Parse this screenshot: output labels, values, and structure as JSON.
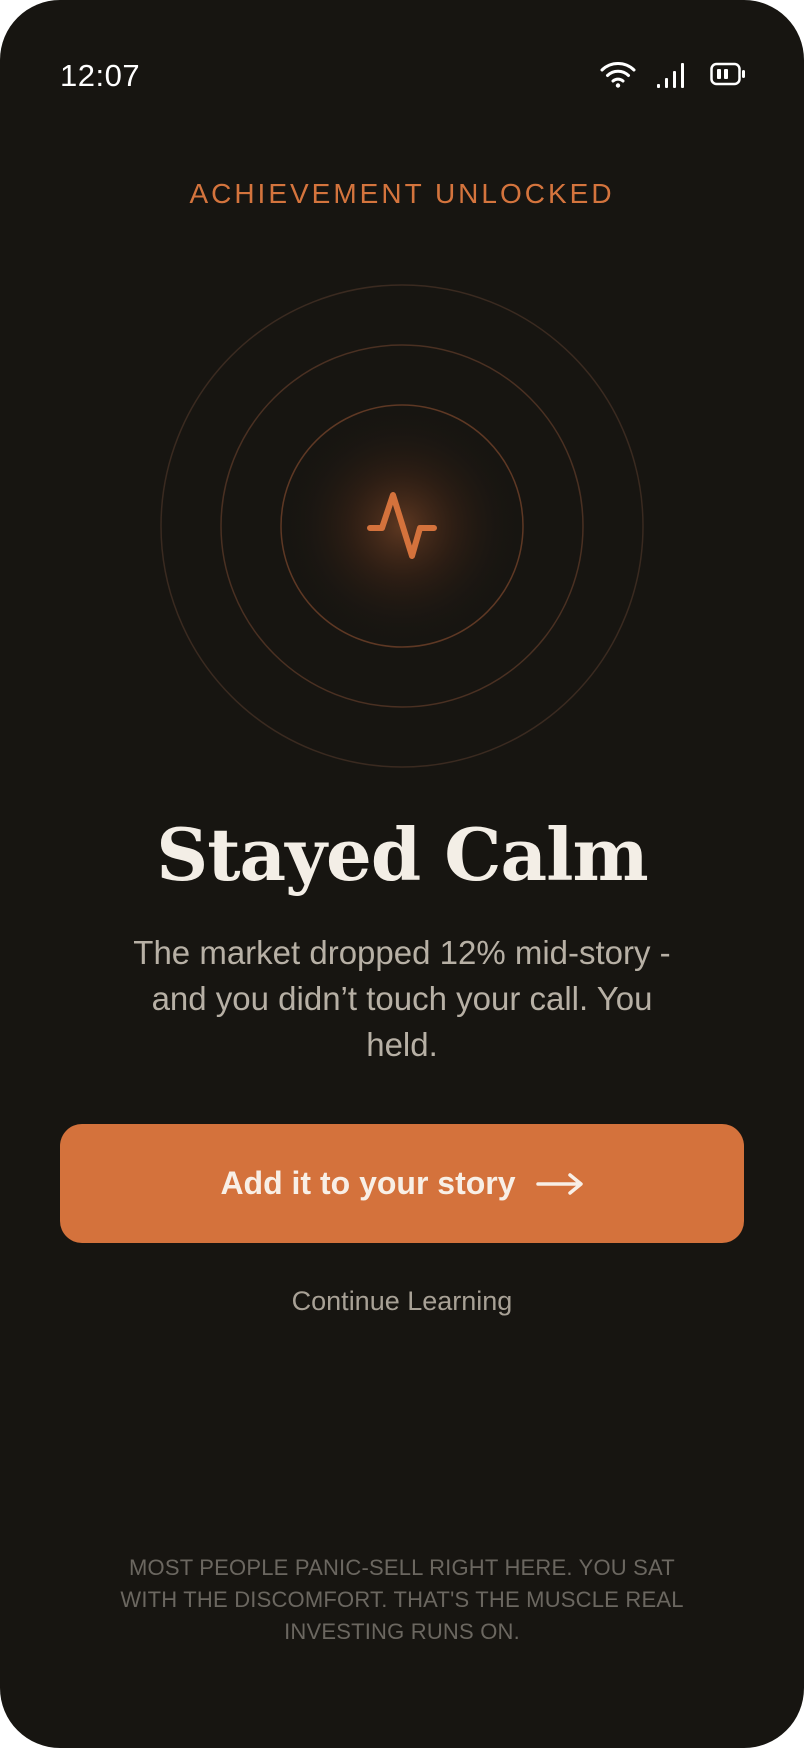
{
  "status_bar": {
    "time": "12:07",
    "icons": [
      "wifi-icon",
      "signal-icon",
      "battery-icon"
    ]
  },
  "achievement": {
    "eyebrow": "ACHIEVEMENT UNLOCKED",
    "badge_icon": "pulse-icon",
    "title": "Stayed Calm",
    "description": "The market dropped 12% mid-story - and you didn’t touch your call. You held."
  },
  "actions": {
    "primary_label": "Add it to your story",
    "primary_icon": "arrow-right-icon",
    "secondary_label": "Continue Learning"
  },
  "footnote": "MOST PEOPLE PANIC-SELL RIGHT HERE. YOU SAT WITH THE DISCOMFORT. THAT'S THE MUSCLE REAL INVESTING RUNS ON.",
  "colors": {
    "background": "#171511",
    "accent": "#d4723c",
    "title": "#f3eee6",
    "body": "#b7b0a5",
    "muted": "#6b6760"
  }
}
